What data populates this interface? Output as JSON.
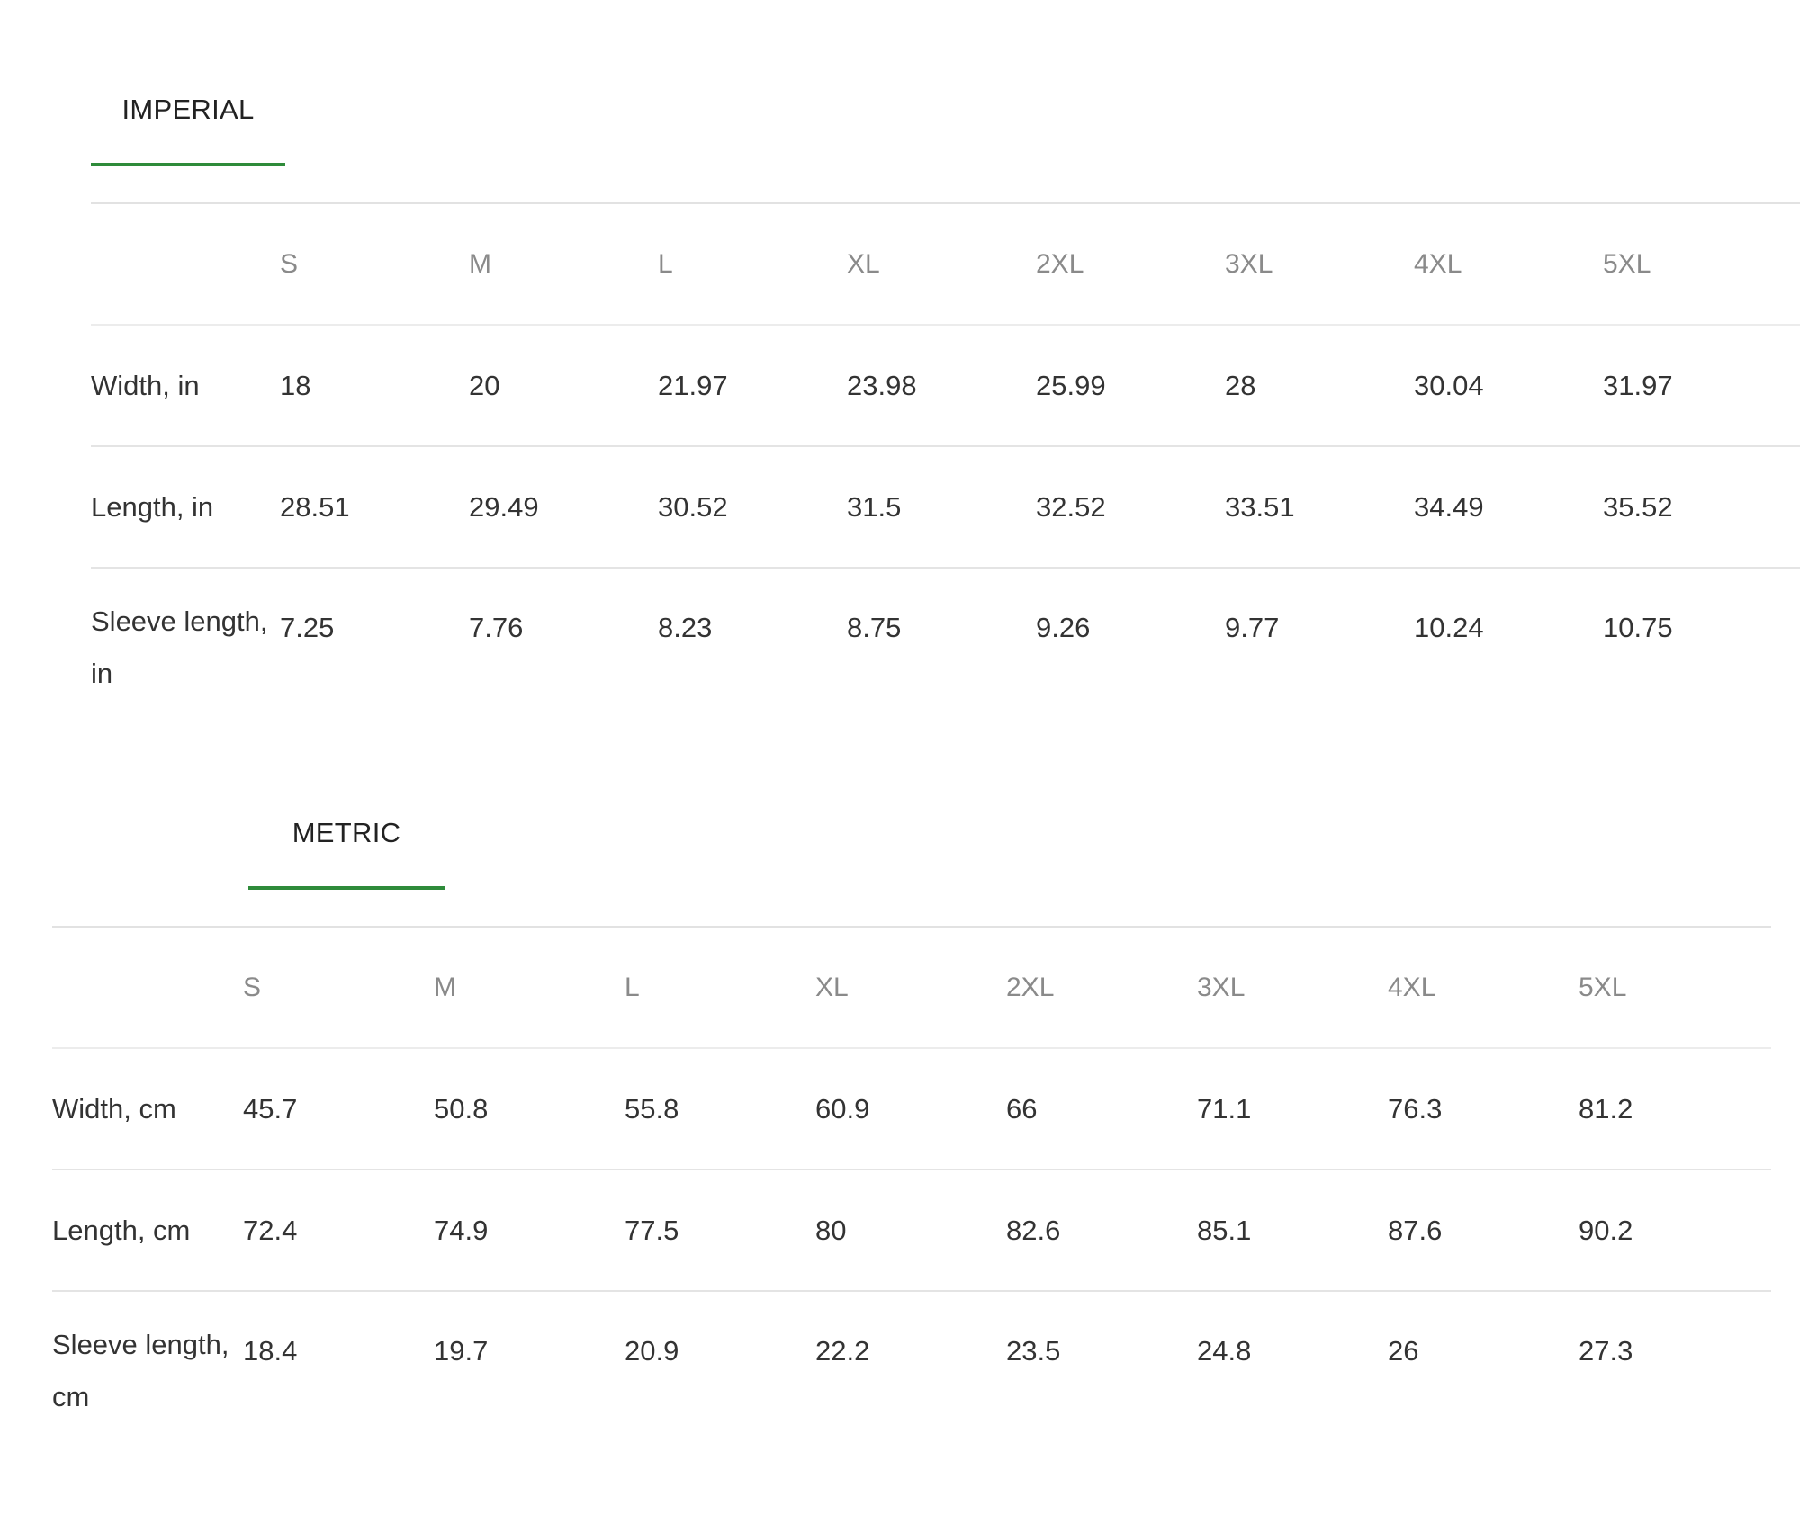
{
  "imperial": {
    "tab_label": "IMPERIAL",
    "sizes": [
      "S",
      "M",
      "L",
      "XL",
      "2XL",
      "3XL",
      "4XL",
      "5XL"
    ],
    "rows": [
      {
        "label": "Width, in",
        "values": [
          "18",
          "20",
          "21.97",
          "23.98",
          "25.99",
          "28",
          "30.04",
          "31.97"
        ]
      },
      {
        "label": "Length, in",
        "values": [
          "28.51",
          "29.49",
          "30.52",
          "31.5",
          "32.52",
          "33.51",
          "34.49",
          "35.52"
        ]
      },
      {
        "label": "Sleeve length, in",
        "values": [
          "7.25",
          "7.76",
          "8.23",
          "8.75",
          "9.26",
          "9.77",
          "10.24",
          "10.75"
        ]
      }
    ]
  },
  "metric": {
    "tab_label": "METRIC",
    "sizes": [
      "S",
      "M",
      "L",
      "XL",
      "2XL",
      "3XL",
      "4XL",
      "5XL"
    ],
    "rows": [
      {
        "label": "Width, cm",
        "values": [
          "45.7",
          "50.8",
          "55.8",
          "60.9",
          "66",
          "71.1",
          "76.3",
          "81.2"
        ]
      },
      {
        "label": "Length, cm",
        "values": [
          "72.4",
          "74.9",
          "77.5",
          "80",
          "82.6",
          "85.1",
          "87.6",
          "90.2"
        ]
      },
      {
        "label": "Sleeve length, cm",
        "values": [
          "18.4",
          "19.7",
          "20.9",
          "22.2",
          "23.5",
          "24.8",
          "26",
          "27.3"
        ]
      }
    ]
  },
  "colors": {
    "accent": "#2e8b3a",
    "header_text": "#8a8a8a",
    "body_text": "#333333",
    "divider": "#e4e4e4"
  }
}
